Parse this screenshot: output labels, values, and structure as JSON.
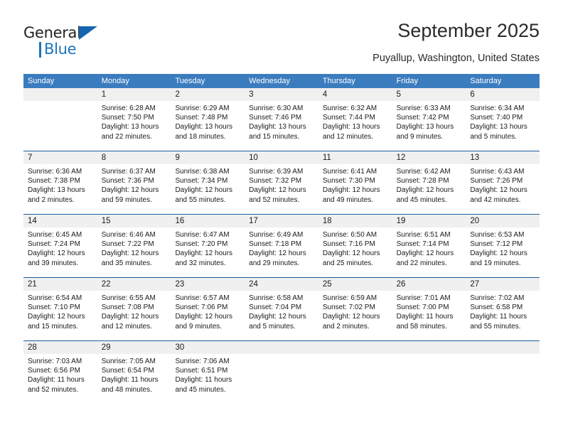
{
  "brand": {
    "name_part1": "General",
    "name_part2": "Blue",
    "logo_icon": "triangle-icon",
    "accent_color": "#1b75bb"
  },
  "header": {
    "title": "September 2025",
    "subtitle": "Puyallup, Washington, United States"
  },
  "theme": {
    "header_row_bg": "#3b7cbf",
    "week_divider": "#1b5fa0",
    "date_band_bg": "#f0f0f0",
    "text": "#1a1a1a"
  },
  "calendar": {
    "weekday_headers": [
      "Sunday",
      "Monday",
      "Tuesday",
      "Wednesday",
      "Thursday",
      "Friday",
      "Saturday"
    ],
    "weeks": [
      [
        {
          "date": "",
          "lines": []
        },
        {
          "date": "1",
          "lines": [
            "Sunrise: 6:28 AM",
            "Sunset: 7:50 PM",
            "Daylight: 13 hours",
            "and 22 minutes."
          ]
        },
        {
          "date": "2",
          "lines": [
            "Sunrise: 6:29 AM",
            "Sunset: 7:48 PM",
            "Daylight: 13 hours",
            "and 18 minutes."
          ]
        },
        {
          "date": "3",
          "lines": [
            "Sunrise: 6:30 AM",
            "Sunset: 7:46 PM",
            "Daylight: 13 hours",
            "and 15 minutes."
          ]
        },
        {
          "date": "4",
          "lines": [
            "Sunrise: 6:32 AM",
            "Sunset: 7:44 PM",
            "Daylight: 13 hours",
            "and 12 minutes."
          ]
        },
        {
          "date": "5",
          "lines": [
            "Sunrise: 6:33 AM",
            "Sunset: 7:42 PM",
            "Daylight: 13 hours",
            "and 9 minutes."
          ]
        },
        {
          "date": "6",
          "lines": [
            "Sunrise: 6:34 AM",
            "Sunset: 7:40 PM",
            "Daylight: 13 hours",
            "and 5 minutes."
          ]
        }
      ],
      [
        {
          "date": "7",
          "lines": [
            "Sunrise: 6:36 AM",
            "Sunset: 7:38 PM",
            "Daylight: 13 hours",
            "and 2 minutes."
          ]
        },
        {
          "date": "8",
          "lines": [
            "Sunrise: 6:37 AM",
            "Sunset: 7:36 PM",
            "Daylight: 12 hours",
            "and 59 minutes."
          ]
        },
        {
          "date": "9",
          "lines": [
            "Sunrise: 6:38 AM",
            "Sunset: 7:34 PM",
            "Daylight: 12 hours",
            "and 55 minutes."
          ]
        },
        {
          "date": "10",
          "lines": [
            "Sunrise: 6:39 AM",
            "Sunset: 7:32 PM",
            "Daylight: 12 hours",
            "and 52 minutes."
          ]
        },
        {
          "date": "11",
          "lines": [
            "Sunrise: 6:41 AM",
            "Sunset: 7:30 PM",
            "Daylight: 12 hours",
            "and 49 minutes."
          ]
        },
        {
          "date": "12",
          "lines": [
            "Sunrise: 6:42 AM",
            "Sunset: 7:28 PM",
            "Daylight: 12 hours",
            "and 45 minutes."
          ]
        },
        {
          "date": "13",
          "lines": [
            "Sunrise: 6:43 AM",
            "Sunset: 7:26 PM",
            "Daylight: 12 hours",
            "and 42 minutes."
          ]
        }
      ],
      [
        {
          "date": "14",
          "lines": [
            "Sunrise: 6:45 AM",
            "Sunset: 7:24 PM",
            "Daylight: 12 hours",
            "and 39 minutes."
          ]
        },
        {
          "date": "15",
          "lines": [
            "Sunrise: 6:46 AM",
            "Sunset: 7:22 PM",
            "Daylight: 12 hours",
            "and 35 minutes."
          ]
        },
        {
          "date": "16",
          "lines": [
            "Sunrise: 6:47 AM",
            "Sunset: 7:20 PM",
            "Daylight: 12 hours",
            "and 32 minutes."
          ]
        },
        {
          "date": "17",
          "lines": [
            "Sunrise: 6:49 AM",
            "Sunset: 7:18 PM",
            "Daylight: 12 hours",
            "and 29 minutes."
          ]
        },
        {
          "date": "18",
          "lines": [
            "Sunrise: 6:50 AM",
            "Sunset: 7:16 PM",
            "Daylight: 12 hours",
            "and 25 minutes."
          ]
        },
        {
          "date": "19",
          "lines": [
            "Sunrise: 6:51 AM",
            "Sunset: 7:14 PM",
            "Daylight: 12 hours",
            "and 22 minutes."
          ]
        },
        {
          "date": "20",
          "lines": [
            "Sunrise: 6:53 AM",
            "Sunset: 7:12 PM",
            "Daylight: 12 hours",
            "and 19 minutes."
          ]
        }
      ],
      [
        {
          "date": "21",
          "lines": [
            "Sunrise: 6:54 AM",
            "Sunset: 7:10 PM",
            "Daylight: 12 hours",
            "and 15 minutes."
          ]
        },
        {
          "date": "22",
          "lines": [
            "Sunrise: 6:55 AM",
            "Sunset: 7:08 PM",
            "Daylight: 12 hours",
            "and 12 minutes."
          ]
        },
        {
          "date": "23",
          "lines": [
            "Sunrise: 6:57 AM",
            "Sunset: 7:06 PM",
            "Daylight: 12 hours",
            "and 9 minutes."
          ]
        },
        {
          "date": "24",
          "lines": [
            "Sunrise: 6:58 AM",
            "Sunset: 7:04 PM",
            "Daylight: 12 hours",
            "and 5 minutes."
          ]
        },
        {
          "date": "25",
          "lines": [
            "Sunrise: 6:59 AM",
            "Sunset: 7:02 PM",
            "Daylight: 12 hours",
            "and 2 minutes."
          ]
        },
        {
          "date": "26",
          "lines": [
            "Sunrise: 7:01 AM",
            "Sunset: 7:00 PM",
            "Daylight: 11 hours",
            "and 58 minutes."
          ]
        },
        {
          "date": "27",
          "lines": [
            "Sunrise: 7:02 AM",
            "Sunset: 6:58 PM",
            "Daylight: 11 hours",
            "and 55 minutes."
          ]
        }
      ],
      [
        {
          "date": "28",
          "lines": [
            "Sunrise: 7:03 AM",
            "Sunset: 6:56 PM",
            "Daylight: 11 hours",
            "and 52 minutes."
          ]
        },
        {
          "date": "29",
          "lines": [
            "Sunrise: 7:05 AM",
            "Sunset: 6:54 PM",
            "Daylight: 11 hours",
            "and 48 minutes."
          ]
        },
        {
          "date": "30",
          "lines": [
            "Sunrise: 7:06 AM",
            "Sunset: 6:51 PM",
            "Daylight: 11 hours",
            "and 45 minutes."
          ]
        },
        {
          "date": "",
          "lines": []
        },
        {
          "date": "",
          "lines": []
        },
        {
          "date": "",
          "lines": []
        },
        {
          "date": "",
          "lines": []
        }
      ]
    ]
  }
}
